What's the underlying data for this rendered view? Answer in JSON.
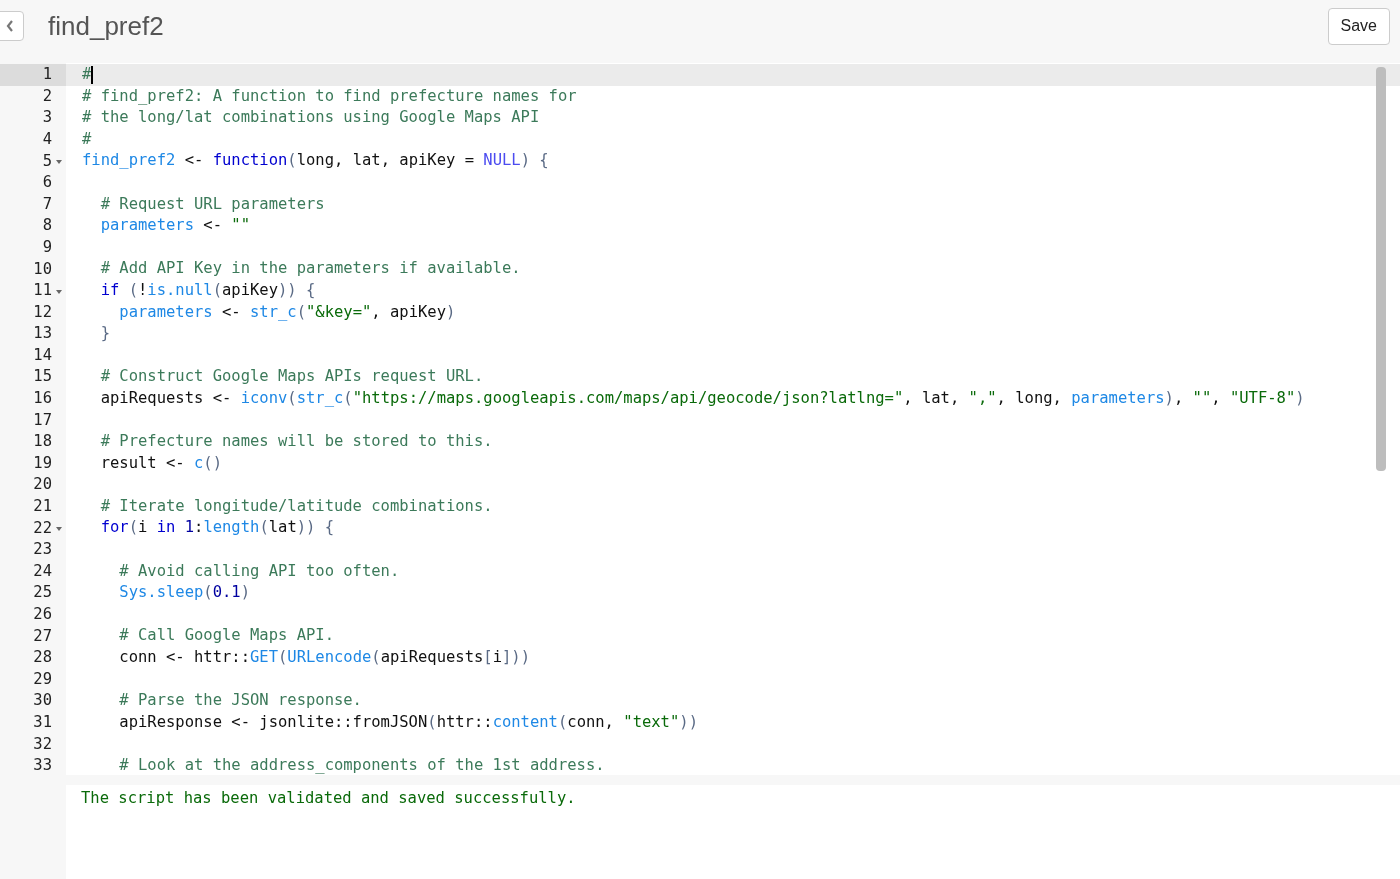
{
  "header": {
    "title": "find_pref2",
    "save_button": "Save"
  },
  "editor": {
    "lines": [
      {
        "number": "1",
        "active": true,
        "foldable": false,
        "tokens": [
          {
            "kind": "comment",
            "text": "#"
          }
        ]
      },
      {
        "number": "2",
        "active": false,
        "foldable": false,
        "tokens": [
          {
            "kind": "comment",
            "text": "# find_pref2: A function to find prefecture names for"
          }
        ]
      },
      {
        "number": "3",
        "active": false,
        "foldable": false,
        "tokens": [
          {
            "kind": "comment",
            "text": "# the long/lat combinations using Google Maps API"
          }
        ]
      },
      {
        "number": "4",
        "active": false,
        "foldable": false,
        "tokens": [
          {
            "kind": "comment",
            "text": "#"
          }
        ]
      },
      {
        "number": "5",
        "active": false,
        "foldable": true,
        "tokens": [
          {
            "kind": "func",
            "text": "find_pref2"
          },
          {
            "kind": "plain",
            "text": " <- "
          },
          {
            "kind": "keyword",
            "text": "function"
          },
          {
            "kind": "punct",
            "text": "("
          },
          {
            "kind": "plain",
            "text": "long, lat, apiKey = "
          },
          {
            "kind": "constant",
            "text": "NULL"
          },
          {
            "kind": "punct",
            "text": ") {"
          }
        ]
      },
      {
        "number": "6",
        "active": false,
        "foldable": false
      },
      {
        "number": "7",
        "active": false,
        "foldable": false,
        "tokens": [
          {
            "kind": "comment",
            "text": "  # Request URL parameters"
          }
        ]
      },
      {
        "number": "8",
        "active": false,
        "foldable": false,
        "tokens": [
          {
            "kind": "func",
            "text": "  parameters"
          },
          {
            "kind": "plain",
            "text": " <- "
          },
          {
            "kind": "string",
            "text": "\"\""
          }
        ]
      },
      {
        "number": "9",
        "active": false,
        "foldable": false
      },
      {
        "number": "10",
        "active": false,
        "foldable": false,
        "tokens": [
          {
            "kind": "comment",
            "text": "  # Add API Key in the parameters if available."
          }
        ]
      },
      {
        "number": "11",
        "active": false,
        "foldable": true,
        "tokens": [
          {
            "kind": "keyword",
            "text": "  if"
          },
          {
            "kind": "punct",
            "text": " ("
          },
          {
            "kind": "plain",
            "text": "!"
          },
          {
            "kind": "func",
            "text": "is.null"
          },
          {
            "kind": "punct",
            "text": "("
          },
          {
            "kind": "plain",
            "text": "apiKey"
          },
          {
            "kind": "punct",
            "text": ")) {"
          }
        ]
      },
      {
        "number": "12",
        "active": false,
        "foldable": false,
        "tokens": [
          {
            "kind": "func",
            "text": "    parameters"
          },
          {
            "kind": "plain",
            "text": " <- "
          },
          {
            "kind": "func",
            "text": "str_c"
          },
          {
            "kind": "punct",
            "text": "("
          },
          {
            "kind": "string",
            "text": "\"&key=\""
          },
          {
            "kind": "plain",
            "text": ", apiKey"
          },
          {
            "kind": "punct",
            "text": ")"
          }
        ]
      },
      {
        "number": "13",
        "active": false,
        "foldable": false,
        "tokens": [
          {
            "kind": "punct",
            "text": "  }"
          }
        ]
      },
      {
        "number": "14",
        "active": false,
        "foldable": false
      },
      {
        "number": "15",
        "active": false,
        "foldable": false,
        "tokens": [
          {
            "kind": "comment",
            "text": "  # Construct Google Maps APIs request URL."
          }
        ]
      },
      {
        "number": "16",
        "active": false,
        "foldable": false,
        "tokens": [
          {
            "kind": "plain",
            "text": "  apiRequests <- "
          },
          {
            "kind": "func",
            "text": "iconv"
          },
          {
            "kind": "punct",
            "text": "("
          },
          {
            "kind": "func",
            "text": "str_c"
          },
          {
            "kind": "punct",
            "text": "("
          },
          {
            "kind": "string",
            "text": "\"https://maps.googleapis.com/maps/api/geocode/json?latlng=\""
          },
          {
            "kind": "plain",
            "text": ", lat, "
          },
          {
            "kind": "string",
            "text": "\",\""
          },
          {
            "kind": "plain",
            "text": ", long, "
          },
          {
            "kind": "func",
            "text": "parameters"
          },
          {
            "kind": "punct",
            "text": ")"
          },
          {
            "kind": "plain",
            "text": ", "
          },
          {
            "kind": "string",
            "text": "\"\""
          },
          {
            "kind": "plain",
            "text": ", "
          },
          {
            "kind": "string",
            "text": "\"UTF-8\""
          },
          {
            "kind": "punct",
            "text": ")"
          }
        ]
      },
      {
        "number": "17",
        "active": false,
        "foldable": false
      },
      {
        "number": "18",
        "active": false,
        "foldable": false,
        "tokens": [
          {
            "kind": "comment",
            "text": "  # Prefecture names will be stored to this."
          }
        ]
      },
      {
        "number": "19",
        "active": false,
        "foldable": false,
        "tokens": [
          {
            "kind": "plain",
            "text": "  result <- "
          },
          {
            "kind": "func",
            "text": "c"
          },
          {
            "kind": "punct",
            "text": "()"
          }
        ]
      },
      {
        "number": "20",
        "active": false,
        "foldable": false
      },
      {
        "number": "21",
        "active": false,
        "foldable": false,
        "tokens": [
          {
            "kind": "comment",
            "text": "  # Iterate longitude/latitude combinations."
          }
        ]
      },
      {
        "number": "22",
        "active": false,
        "foldable": true,
        "tokens": [
          {
            "kind": "keyword",
            "text": "  for"
          },
          {
            "kind": "punct",
            "text": "("
          },
          {
            "kind": "plain",
            "text": "i "
          },
          {
            "kind": "keyword",
            "text": "in"
          },
          {
            "kind": "number",
            "text": " 1"
          },
          {
            "kind": "plain",
            "text": ":"
          },
          {
            "kind": "func",
            "text": "length"
          },
          {
            "kind": "punct",
            "text": "("
          },
          {
            "kind": "plain",
            "text": "lat"
          },
          {
            "kind": "punct",
            "text": ")) {"
          }
        ]
      },
      {
        "number": "23",
        "active": false,
        "foldable": false
      },
      {
        "number": "24",
        "active": false,
        "foldable": false,
        "tokens": [
          {
            "kind": "comment",
            "text": "    # Avoid calling API too often."
          }
        ]
      },
      {
        "number": "25",
        "active": false,
        "foldable": false,
        "tokens": [
          {
            "kind": "func",
            "text": "    Sys.sleep"
          },
          {
            "kind": "punct",
            "text": "("
          },
          {
            "kind": "number",
            "text": "0.1"
          },
          {
            "kind": "punct",
            "text": ")"
          }
        ]
      },
      {
        "number": "26",
        "active": false,
        "foldable": false
      },
      {
        "number": "27",
        "active": false,
        "foldable": false,
        "tokens": [
          {
            "kind": "comment",
            "text": "    # Call Google Maps API."
          }
        ]
      },
      {
        "number": "28",
        "active": false,
        "foldable": false,
        "tokens": [
          {
            "kind": "plain",
            "text": "    conn <- httr::"
          },
          {
            "kind": "func",
            "text": "GET"
          },
          {
            "kind": "punct",
            "text": "("
          },
          {
            "kind": "func",
            "text": "URLencode"
          },
          {
            "kind": "punct",
            "text": "("
          },
          {
            "kind": "plain",
            "text": "apiRequests"
          },
          {
            "kind": "punct",
            "text": "["
          },
          {
            "kind": "plain",
            "text": "i"
          },
          {
            "kind": "punct",
            "text": "]))"
          }
        ]
      },
      {
        "number": "29",
        "active": false,
        "foldable": false
      },
      {
        "number": "30",
        "active": false,
        "foldable": false,
        "tokens": [
          {
            "kind": "comment",
            "text": "    # Parse the JSON response."
          }
        ]
      },
      {
        "number": "31",
        "active": false,
        "foldable": false,
        "tokens": [
          {
            "kind": "plain",
            "text": "    apiResponse <- jsonlite::fromJSON"
          },
          {
            "kind": "punct",
            "text": "("
          },
          {
            "kind": "plain",
            "text": "httr::"
          },
          {
            "kind": "func",
            "text": "content"
          },
          {
            "kind": "punct",
            "text": "("
          },
          {
            "kind": "plain",
            "text": "conn, "
          },
          {
            "kind": "string",
            "text": "\"text\""
          },
          {
            "kind": "punct",
            "text": "))"
          }
        ]
      },
      {
        "number": "32",
        "active": false,
        "foldable": false
      },
      {
        "number": "33",
        "active": false,
        "foldable": false,
        "tokens": [
          {
            "kind": "comment",
            "text": "    # Look at the address_components of the 1st address."
          }
        ]
      }
    ]
  },
  "message": "The script has been validated and saved successfully."
}
